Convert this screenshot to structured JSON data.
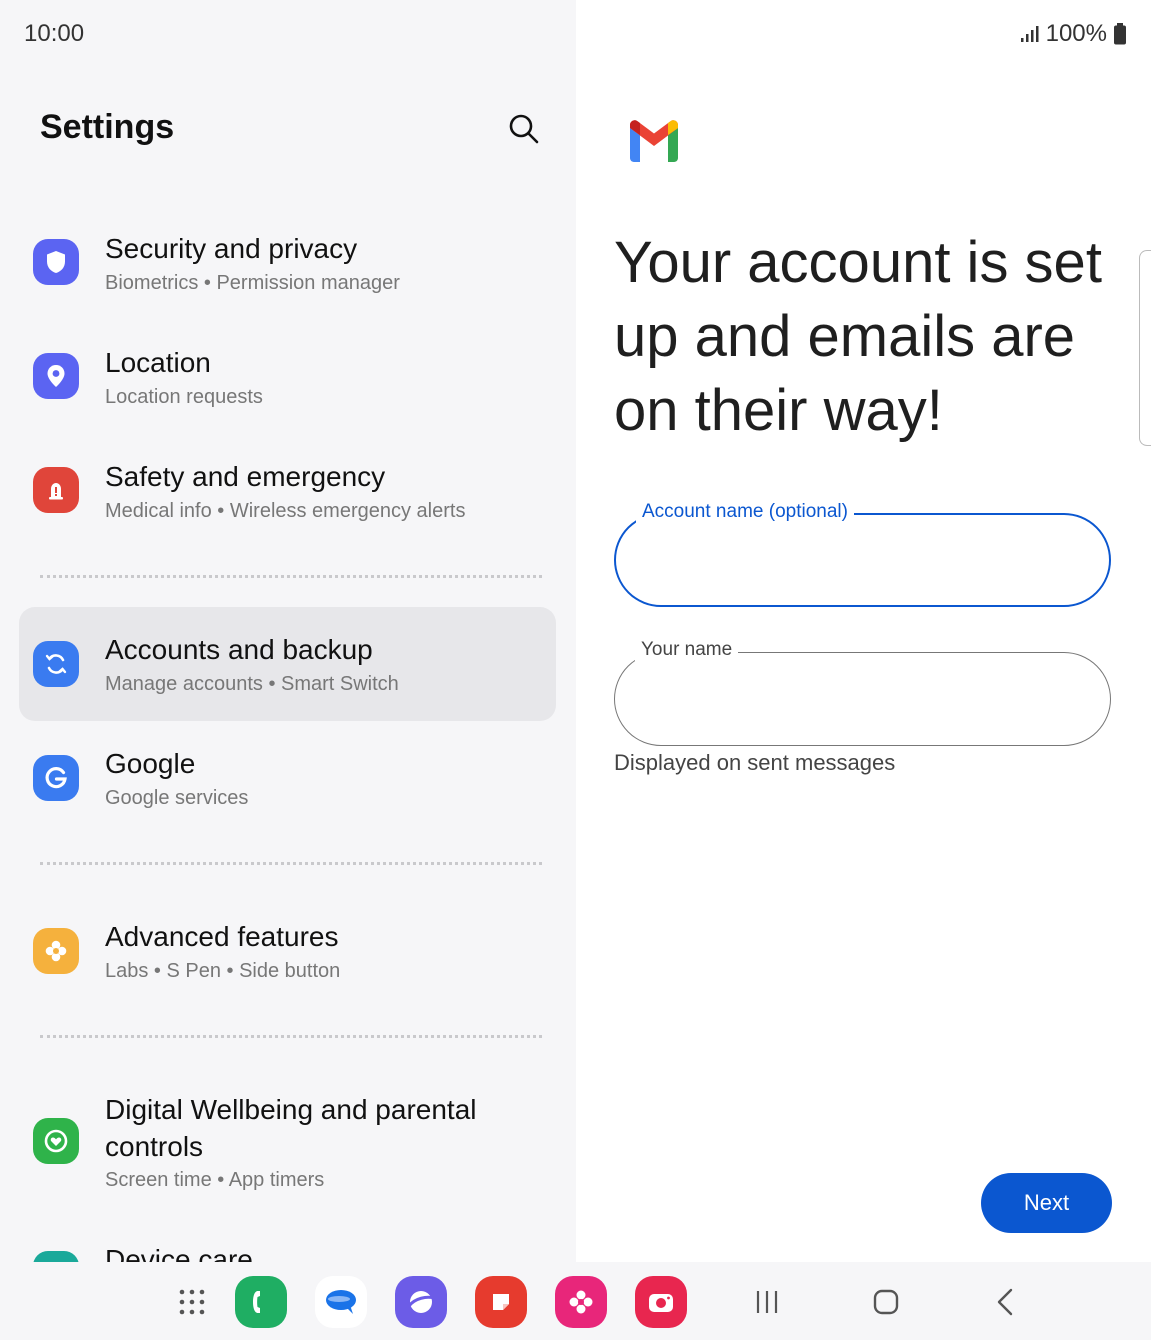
{
  "status_bar": {
    "time": "10:00",
    "battery": "100%"
  },
  "settings": {
    "title": "Settings",
    "items": [
      {
        "title": "Security and privacy",
        "subtitle": "Biometrics  •  Permission manager",
        "icon": "shield-icon",
        "color": "#5b64f2"
      },
      {
        "title": "Location",
        "subtitle": "Location requests",
        "icon": "location-pin-icon",
        "color": "#5b64f2"
      },
      {
        "title": "Safety and emergency",
        "subtitle": "Medical info  •  Wireless emergency alerts",
        "icon": "emergency-icon",
        "color": "#e0453a"
      },
      {
        "title": "Accounts and backup",
        "subtitle": "Manage accounts  •  Smart Switch",
        "icon": "sync-icon",
        "color": "#3a7bf0",
        "selected": true
      },
      {
        "title": "Google",
        "subtitle": "Google services",
        "icon": "google-icon",
        "color": "#3a7bf0"
      },
      {
        "title": "Advanced features",
        "subtitle": "Labs  •  S Pen  •  Side button",
        "icon": "advanced-features-icon",
        "color": "#f5b13d"
      },
      {
        "title": "Digital Wellbeing and parental controls",
        "subtitle": "Screen time  •  App timers",
        "icon": "wellbeing-icon",
        "color": "#2fb34a"
      },
      {
        "title": "Device care",
        "icon": "device-care-icon",
        "color": "#1aa99a"
      }
    ]
  },
  "gmail": {
    "headline": "Your account is set up and emails are on their way!",
    "account_name_label": "Account name (optional)",
    "account_name_value": "",
    "your_name_label": "Your name",
    "your_name_value": "",
    "helper_text": "Displayed on sent messages",
    "next_button": "Next",
    "accent_color": "#0b57d0"
  },
  "taskbar": {
    "apps": [
      "apps-grid-icon",
      "phone-icon",
      "messages-icon",
      "internet-icon",
      "notes-icon",
      "gallery-icon",
      "camera-icon"
    ],
    "nav": [
      "recent-apps-icon",
      "home-icon",
      "back-icon"
    ]
  }
}
